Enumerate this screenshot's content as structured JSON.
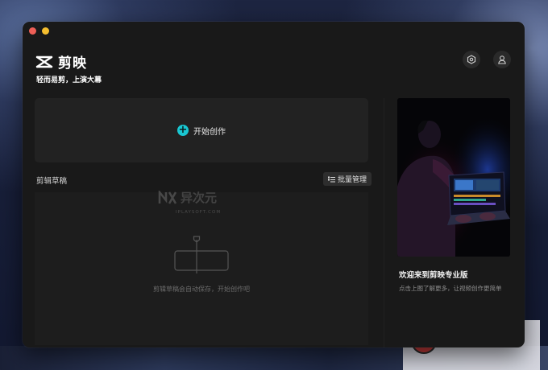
{
  "app": {
    "name": "剪映",
    "slogan": "轻而易剪，上演大幕"
  },
  "header": {
    "settings_icon": "settings-hexagon-icon",
    "user_icon": "user-icon"
  },
  "create": {
    "label": "开始创作",
    "icon": "plus-circle-icon",
    "accent": "#19c7d2"
  },
  "drafts": {
    "title": "剪辑草稿",
    "batch_manage_label": "批量管理",
    "empty_hint": "剪辑草稿会自动保存，开始创作吧"
  },
  "watermark": {
    "brand": "异次元",
    "site": "IPLAYSOFT.COM"
  },
  "promo": {
    "title": "欢迎来到剪映专业版",
    "subtitle": "点击上图了解更多，让视频创作更简单"
  }
}
